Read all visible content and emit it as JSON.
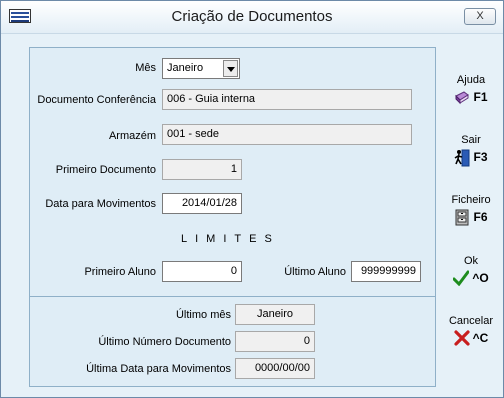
{
  "window": {
    "title": "Criação de Documentos",
    "close_label": "X"
  },
  "form": {
    "mes": {
      "label": "Mês",
      "value": "Janeiro"
    },
    "documento_conferencia": {
      "label": "Documento Conferência",
      "value": "006 - Guia interna"
    },
    "armazem": {
      "label": "Armazém",
      "value": "001 - sede"
    },
    "primeiro_documento": {
      "label": "Primeiro Documento",
      "value": "1"
    },
    "data_movimentos": {
      "label": "Data para Movimentos",
      "value": "2014/01/28"
    },
    "limites_heading": "LIMITES",
    "primeiro_aluno": {
      "label": "Primeiro Aluno",
      "value": "0"
    },
    "ultimo_aluno": {
      "label": "Último Aluno",
      "value": "999999999"
    }
  },
  "summary": {
    "ultimo_mes": {
      "label": "Último mês",
      "value": "Janeiro"
    },
    "ultimo_numero_documento": {
      "label": "Último Número Documento",
      "value": "0"
    },
    "ultima_data_movimentos": {
      "label": "Última Data para Movimentos",
      "value": "0000/00/00"
    }
  },
  "actions": [
    {
      "label": "Ajuda",
      "key": "F1",
      "icon": "book-icon"
    },
    {
      "label": "Sair",
      "key": "F3",
      "icon": "exit-door-icon"
    },
    {
      "label": "Ficheiro",
      "key": "F6",
      "icon": "file-cabinet-icon"
    },
    {
      "label": "Ok",
      "key": "^O",
      "icon": "checkmark-icon"
    },
    {
      "label": "Cancelar",
      "key": "^C",
      "icon": "red-x-icon"
    }
  ]
}
